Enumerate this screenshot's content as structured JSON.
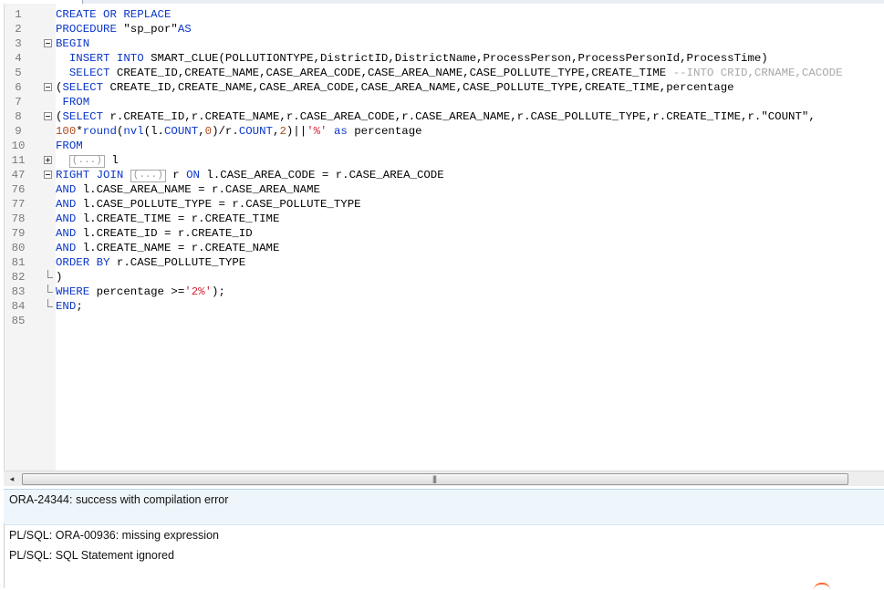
{
  "editor": {
    "lines": [
      {
        "num": "1",
        "fold": "",
        "parts": [
          {
            "t": "CREATE OR REPLACE",
            "c": "kw"
          }
        ]
      },
      {
        "num": "2",
        "fold": "",
        "parts": [
          {
            "t": "PROCEDURE",
            "c": "kw"
          },
          {
            "t": " \"sp_por\"",
            "c": ""
          },
          {
            "t": "AS",
            "c": "kw"
          }
        ]
      },
      {
        "num": "3",
        "fold": "minus",
        "parts": [
          {
            "t": "BEGIN",
            "c": "kw"
          }
        ]
      },
      {
        "num": "4",
        "fold": "",
        "parts": [
          {
            "t": "  ",
            "c": ""
          },
          {
            "t": "INSERT INTO",
            "c": "kw"
          },
          {
            "t": " SMART_CLUE(POLLUTIONTYPE,DistrictID,DistrictName,ProcessPerson,ProcessPersonId,ProcessTime)",
            "c": ""
          }
        ]
      },
      {
        "num": "5",
        "fold": "",
        "parts": [
          {
            "t": "  ",
            "c": ""
          },
          {
            "t": "SELECT",
            "c": "kw"
          },
          {
            "t": " CREATE_ID,CREATE_NAME,CASE_AREA_CODE,CASE_AREA_NAME,CASE_POLLUTE_TYPE,CREATE_TIME ",
            "c": ""
          },
          {
            "t": "--INTO CRID,CRNAME,CACODE",
            "c": "cmt"
          }
        ]
      },
      {
        "num": "6",
        "fold": "minus",
        "parts": [
          {
            "t": "(",
            "c": ""
          },
          {
            "t": "SELECT",
            "c": "kw"
          },
          {
            "t": " CREATE_ID,CREATE_NAME,CASE_AREA_CODE,CASE_AREA_NAME,CASE_POLLUTE_TYPE,CREATE_TIME,percentage",
            "c": ""
          }
        ]
      },
      {
        "num": "7",
        "fold": "",
        "parts": [
          {
            "t": " ",
            "c": ""
          },
          {
            "t": "FROM",
            "c": "kw"
          }
        ]
      },
      {
        "num": "8",
        "fold": "minus",
        "parts": [
          {
            "t": "(",
            "c": ""
          },
          {
            "t": "SELECT",
            "c": "kw"
          },
          {
            "t": " r.CREATE_ID,r.CREATE_NAME,r.CASE_AREA_CODE,r.CASE_AREA_NAME,r.CASE_POLLUTE_TYPE,r.CREATE_TIME,r.\"COUNT\",",
            "c": ""
          }
        ]
      },
      {
        "num": "9",
        "fold": "",
        "parts": [
          {
            "t": "100",
            "c": "num"
          },
          {
            "t": "*",
            "c": ""
          },
          {
            "t": "round",
            "c": "kw"
          },
          {
            "t": "(",
            "c": ""
          },
          {
            "t": "nvl",
            "c": "kw"
          },
          {
            "t": "(l.",
            "c": ""
          },
          {
            "t": "COUNT",
            "c": "kw"
          },
          {
            "t": ",",
            "c": ""
          },
          {
            "t": "0",
            "c": "num"
          },
          {
            "t": ")/r.",
            "c": ""
          },
          {
            "t": "COUNT",
            "c": "kw"
          },
          {
            "t": ",",
            "c": ""
          },
          {
            "t": "2",
            "c": "num"
          },
          {
            "t": ")||",
            "c": ""
          },
          {
            "t": "'%'",
            "c": "str"
          },
          {
            "t": " ",
            "c": ""
          },
          {
            "t": "as",
            "c": "kw"
          },
          {
            "t": " percentage",
            "c": ""
          }
        ]
      },
      {
        "num": "10",
        "fold": "",
        "parts": [
          {
            "t": "FROM",
            "c": "kw"
          }
        ]
      },
      {
        "num": "11",
        "fold": "plus",
        "parts": [
          {
            "t": "  ",
            "c": ""
          },
          {
            "t": "(...)",
            "c": "box"
          },
          {
            "t": " l",
            "c": ""
          }
        ]
      },
      {
        "num": "47",
        "fold": "minus",
        "parts": [
          {
            "t": "RIGHT JOIN",
            "c": "kw"
          },
          {
            "t": " ",
            "c": ""
          },
          {
            "t": "(...)",
            "c": "box"
          },
          {
            "t": " r ",
            "c": ""
          },
          {
            "t": "ON",
            "c": "kw"
          },
          {
            "t": " l.CASE_AREA_CODE = r.CASE_AREA_CODE",
            "c": ""
          }
        ]
      },
      {
        "num": "76",
        "fold": "",
        "parts": [
          {
            "t": "AND",
            "c": "kw"
          },
          {
            "t": " l.CASE_AREA_NAME = r.CASE_AREA_NAME",
            "c": ""
          }
        ]
      },
      {
        "num": "77",
        "fold": "",
        "parts": [
          {
            "t": "AND",
            "c": "kw"
          },
          {
            "t": " l.CASE_POLLUTE_TYPE = r.CASE_POLLUTE_TYPE",
            "c": ""
          }
        ]
      },
      {
        "num": "78",
        "fold": "",
        "parts": [
          {
            "t": "AND",
            "c": "kw"
          },
          {
            "t": " l.CREATE_TIME = r.CREATE_TIME",
            "c": ""
          }
        ]
      },
      {
        "num": "79",
        "fold": "",
        "parts": [
          {
            "t": "AND",
            "c": "kw"
          },
          {
            "t": " l.CREATE_ID = r.CREATE_ID",
            "c": ""
          }
        ]
      },
      {
        "num": "80",
        "fold": "",
        "parts": [
          {
            "t": "AND",
            "c": "kw"
          },
          {
            "t": " l.CREATE_NAME = r.CREATE_NAME",
            "c": ""
          }
        ]
      },
      {
        "num": "81",
        "fold": "",
        "parts": [
          {
            "t": "ORDER BY",
            "c": "kw"
          },
          {
            "t": " r.CASE_POLLUTE_TYPE",
            "c": ""
          }
        ]
      },
      {
        "num": "82",
        "fold": "end",
        "parts": [
          {
            "t": ")",
            "c": ""
          }
        ]
      },
      {
        "num": "83",
        "fold": "end",
        "parts": [
          {
            "t": "WHERE",
            "c": "kw"
          },
          {
            "t": " percentage >=",
            "c": ""
          },
          {
            "t": "'2%'",
            "c": "str"
          },
          {
            "t": ");",
            "c": ""
          }
        ]
      },
      {
        "num": "84",
        "fold": "end",
        "parts": [
          {
            "t": "END",
            "c": "kw"
          },
          {
            "t": ";",
            "c": ""
          }
        ]
      },
      {
        "num": "85",
        "fold": "",
        "parts": []
      }
    ]
  },
  "scrollbar": {
    "left_arrow": "◂",
    "grip": "|||"
  },
  "messages": {
    "compile_status": "ORA-24344: success with compilation error",
    "error_1": "PL/SQL: ORA-00936: missing expression",
    "error_2": "PL/SQL: SQL Statement ignored"
  },
  "colors": {
    "keyword": "#0a36c8",
    "string": "#d7263a",
    "number": "#b04a1e",
    "comment": "#a8a8a8"
  }
}
